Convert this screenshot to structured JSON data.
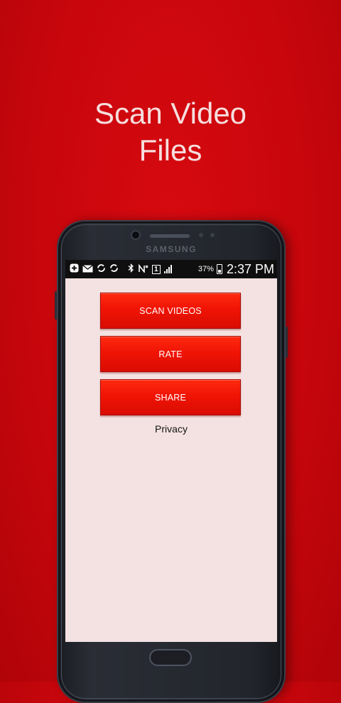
{
  "headline": {
    "line1": "Scan Video",
    "line2": "Files"
  },
  "phone": {
    "brand": "SAMSUNG"
  },
  "statusbar": {
    "icons": [
      "plus-icon",
      "mail-icon",
      "sync-icon",
      "sync-icon",
      "bluetooth-icon",
      "no-signal-icon",
      "sim-icon",
      "signal-icon"
    ],
    "sim_label": "1",
    "battery_pct": "37%",
    "time": "2:37 PM"
  },
  "app": {
    "buttons": {
      "scan": "SCAN VIDEOS",
      "rate": "RATE",
      "share": "SHARE"
    },
    "privacy_link": "Privacy"
  },
  "colors": {
    "background": "#c8060c",
    "button": "#f01405",
    "screen": "#f4e2e2",
    "headline_text": "#f6dede"
  }
}
